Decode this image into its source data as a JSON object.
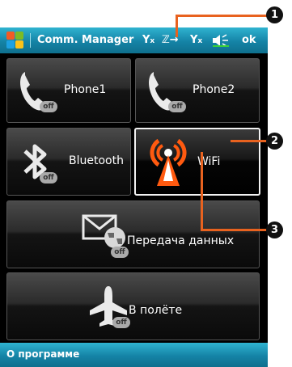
{
  "titlebar": {
    "title": "Comm. Manager",
    "ok_label": "ok",
    "status_icons": [
      "signal-off-icon",
      "data-connection-icon",
      "signal-off-icon",
      "volume-icon"
    ]
  },
  "tiles": {
    "phone1": {
      "label": "Phone1",
      "state": "off"
    },
    "phone2": {
      "label": "Phone2",
      "state": "off"
    },
    "bluetooth": {
      "label": "Bluetooth",
      "state": "off"
    },
    "wifi": {
      "label": "WiFi",
      "state": "on"
    },
    "data": {
      "label": "Передача данных",
      "state": "off"
    },
    "flight": {
      "label": "В полёте",
      "state": "off"
    }
  },
  "bottombar": {
    "about_label": "О программе"
  },
  "callouts": [
    "1",
    "2",
    "3"
  ],
  "colors": {
    "accent": "#1a97bd",
    "callout_line": "#e8621f",
    "wifi_on": "#ff5a10"
  }
}
